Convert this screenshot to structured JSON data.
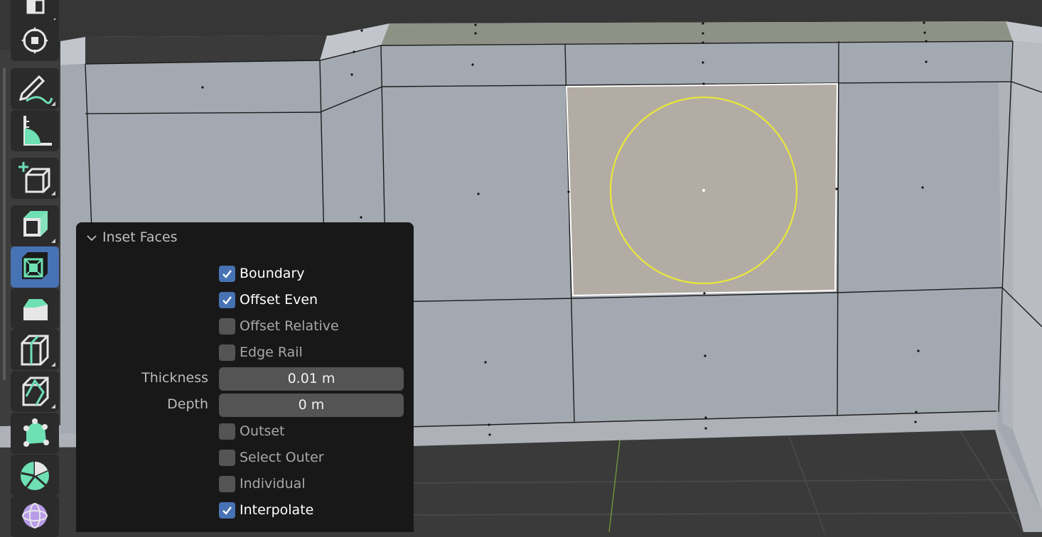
{
  "toolbar": {
    "tools": [
      {
        "icon": "select-box-icon",
        "active": false
      },
      {
        "icon": "cursor-icon",
        "active": false
      },
      {
        "icon": "annotate-icon",
        "active": false
      },
      {
        "icon": "measure-icon",
        "active": false
      },
      {
        "icon": "add-cube-icon",
        "active": false
      },
      {
        "icon": "extrude-region-icon",
        "active": false
      },
      {
        "icon": "inset-faces-icon",
        "active": true
      },
      {
        "icon": "bevel-icon",
        "active": false
      },
      {
        "icon": "loop-cut-icon",
        "active": false
      },
      {
        "icon": "knife-icon",
        "active": false
      },
      {
        "icon": "poly-build-icon",
        "active": false
      },
      {
        "icon": "spin-icon",
        "active": false
      },
      {
        "icon": "smooth-icon",
        "active": false
      }
    ]
  },
  "panel": {
    "title": "Inset Faces",
    "options": {
      "boundary": {
        "label": "Boundary",
        "checked": true
      },
      "offset_even": {
        "label": "Offset Even",
        "checked": true
      },
      "offset_relative": {
        "label": "Offset Relative",
        "checked": false
      },
      "edge_rail": {
        "label": "Edge Rail",
        "checked": false
      },
      "outset": {
        "label": "Outset",
        "checked": false
      },
      "select_outer": {
        "label": "Select Outer",
        "checked": false
      },
      "individual": {
        "label": "Individual",
        "checked": false
      },
      "interpolate": {
        "label": "Interpolate",
        "checked": true
      }
    },
    "thickness": {
      "label": "Thickness",
      "value": "0.01 m"
    },
    "depth": {
      "label": "Depth",
      "value": "0 m"
    }
  },
  "colors": {
    "active_tool": "#4772b3",
    "checkbox_on": "#4772b3",
    "selected_face": "#b3aca4",
    "circle_gizmo": "#e8e83a",
    "wall": "#9da3ab"
  }
}
